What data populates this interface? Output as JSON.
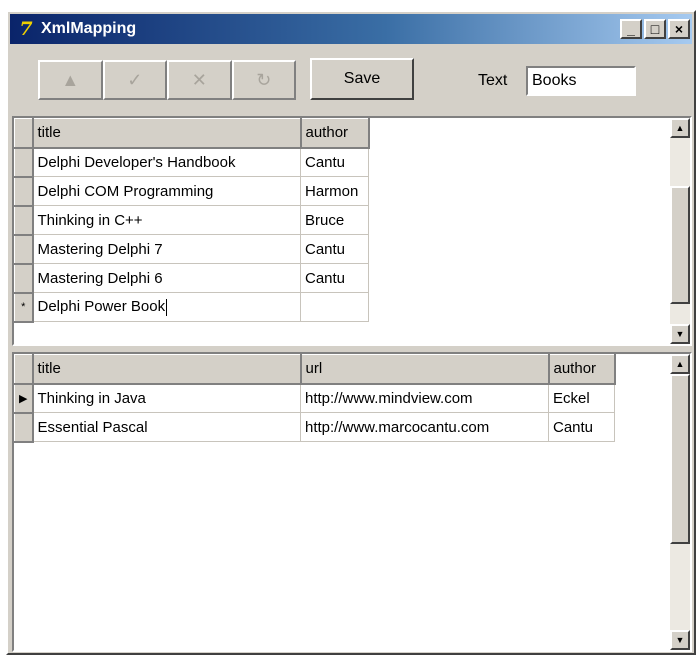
{
  "window": {
    "title": "XmlMapping",
    "icon": "delphi-app-icon",
    "buttons": {
      "minimize": "_",
      "maximize": "□",
      "close": "×"
    }
  },
  "toolbar": {
    "nav_buttons": [
      {
        "name": "insert-record-button",
        "icon": "triangle-up-icon",
        "glyph": "▲"
      },
      {
        "name": "post-edit-button",
        "icon": "checkmark-icon",
        "glyph": "✓"
      },
      {
        "name": "cancel-edit-button",
        "icon": "x-icon",
        "glyph": "✕"
      },
      {
        "name": "refresh-button",
        "icon": "refresh-icon",
        "glyph": "↻"
      }
    ],
    "save_label": "Save",
    "text_label": "Text",
    "text_value": "Books"
  },
  "grid1": {
    "columns": [
      "title",
      "author"
    ],
    "rows": [
      {
        "title": "Delphi Developer's Handbook",
        "author": "Cantu"
      },
      {
        "title": "Delphi COM Programming",
        "author": "Harmon"
      },
      {
        "title": "Thinking in C++",
        "author": "Bruce"
      },
      {
        "title": "Mastering Delphi 7",
        "author": "Cantu"
      },
      {
        "title": "Mastering Delphi 6",
        "author": "Cantu"
      },
      {
        "title": "Delphi Power Book",
        "author": ""
      }
    ],
    "current_row_indicator": "*"
  },
  "grid2": {
    "columns": [
      "title",
      "url",
      "author"
    ],
    "rows": [
      {
        "title": "Thinking in Java",
        "url": "http://www.mindview.com",
        "author": "Eckel"
      },
      {
        "title": "Essential Pascal",
        "url": "http://www.marcocantu.com",
        "author": "Cantu"
      }
    ],
    "current_row_indicator": "▶"
  },
  "colors": {
    "titlebar_start": "#0a246a",
    "titlebar_end": "#a6caf0",
    "face": "#d4d0c8"
  }
}
